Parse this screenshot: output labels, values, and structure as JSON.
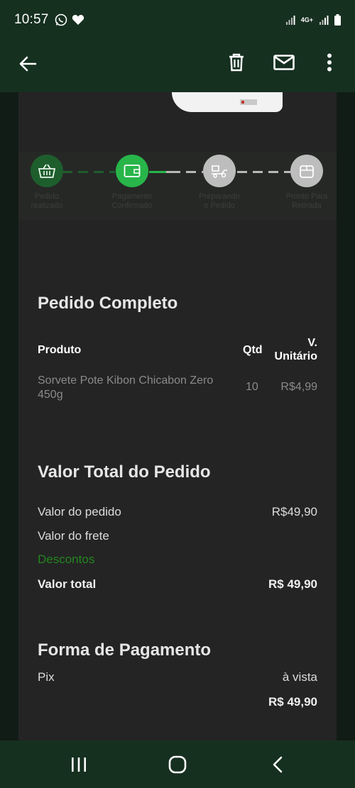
{
  "status_bar": {
    "time": "10:57",
    "left_icons": [
      "whatsapp-icon",
      "heart-icon"
    ],
    "network": "4G+",
    "right_icons": [
      "signal-icon",
      "network-4g-icon",
      "signal-icon",
      "battery-icon"
    ]
  },
  "app_bar": {
    "icons": [
      "back-arrow-icon",
      "trash-icon",
      "mail-icon",
      "more-vert-icon"
    ]
  },
  "progress": {
    "steps": [
      {
        "label_1": "Pedido",
        "label_2": "realizado",
        "icon": "basket-icon",
        "state": "done"
      },
      {
        "label_1": "Pagamento",
        "label_2": "Confirmado",
        "icon": "wallet-icon",
        "state": "current"
      },
      {
        "label_1": "Preparando",
        "label_2": "o Pedido",
        "icon": "truck-icon",
        "state": "pending"
      },
      {
        "label_1": "Pronto Para",
        "label_2": "Retirada",
        "icon": "box-icon",
        "state": "pending"
      }
    ]
  },
  "order": {
    "title": "Pedido Completo",
    "headers": {
      "product": "Produto",
      "qty": "Qtd",
      "unit_1": "V.",
      "unit_2": "Unitário"
    },
    "items": [
      {
        "name_1": "Sorvete Pote Kibon Chicabon Zero",
        "name_2": "450g",
        "qty": "10",
        "unit_price": "R$4,99"
      }
    ]
  },
  "totals": {
    "title": "Valor Total do Pedido",
    "order_value_label": "Valor do pedido",
    "order_value": "R$49,90",
    "shipping_label": "Valor do frete",
    "discount_label": "Descontos",
    "total_label": "Valor total",
    "total": "R$ 49,90"
  },
  "payment": {
    "title": "Forma de Pagamento",
    "method": "Pix",
    "terms": "à vista",
    "amount": "R$ 49,90"
  },
  "nav": {
    "icons": [
      "recent-apps-icon",
      "home-icon",
      "back-icon"
    ]
  },
  "colors": {
    "bar_bg": "#163020",
    "card_bg": "#242424",
    "step_done": "#1e5e2d",
    "step_current": "#28b54a",
    "step_pending": "#bdbdbd",
    "discount": "#23861f"
  }
}
